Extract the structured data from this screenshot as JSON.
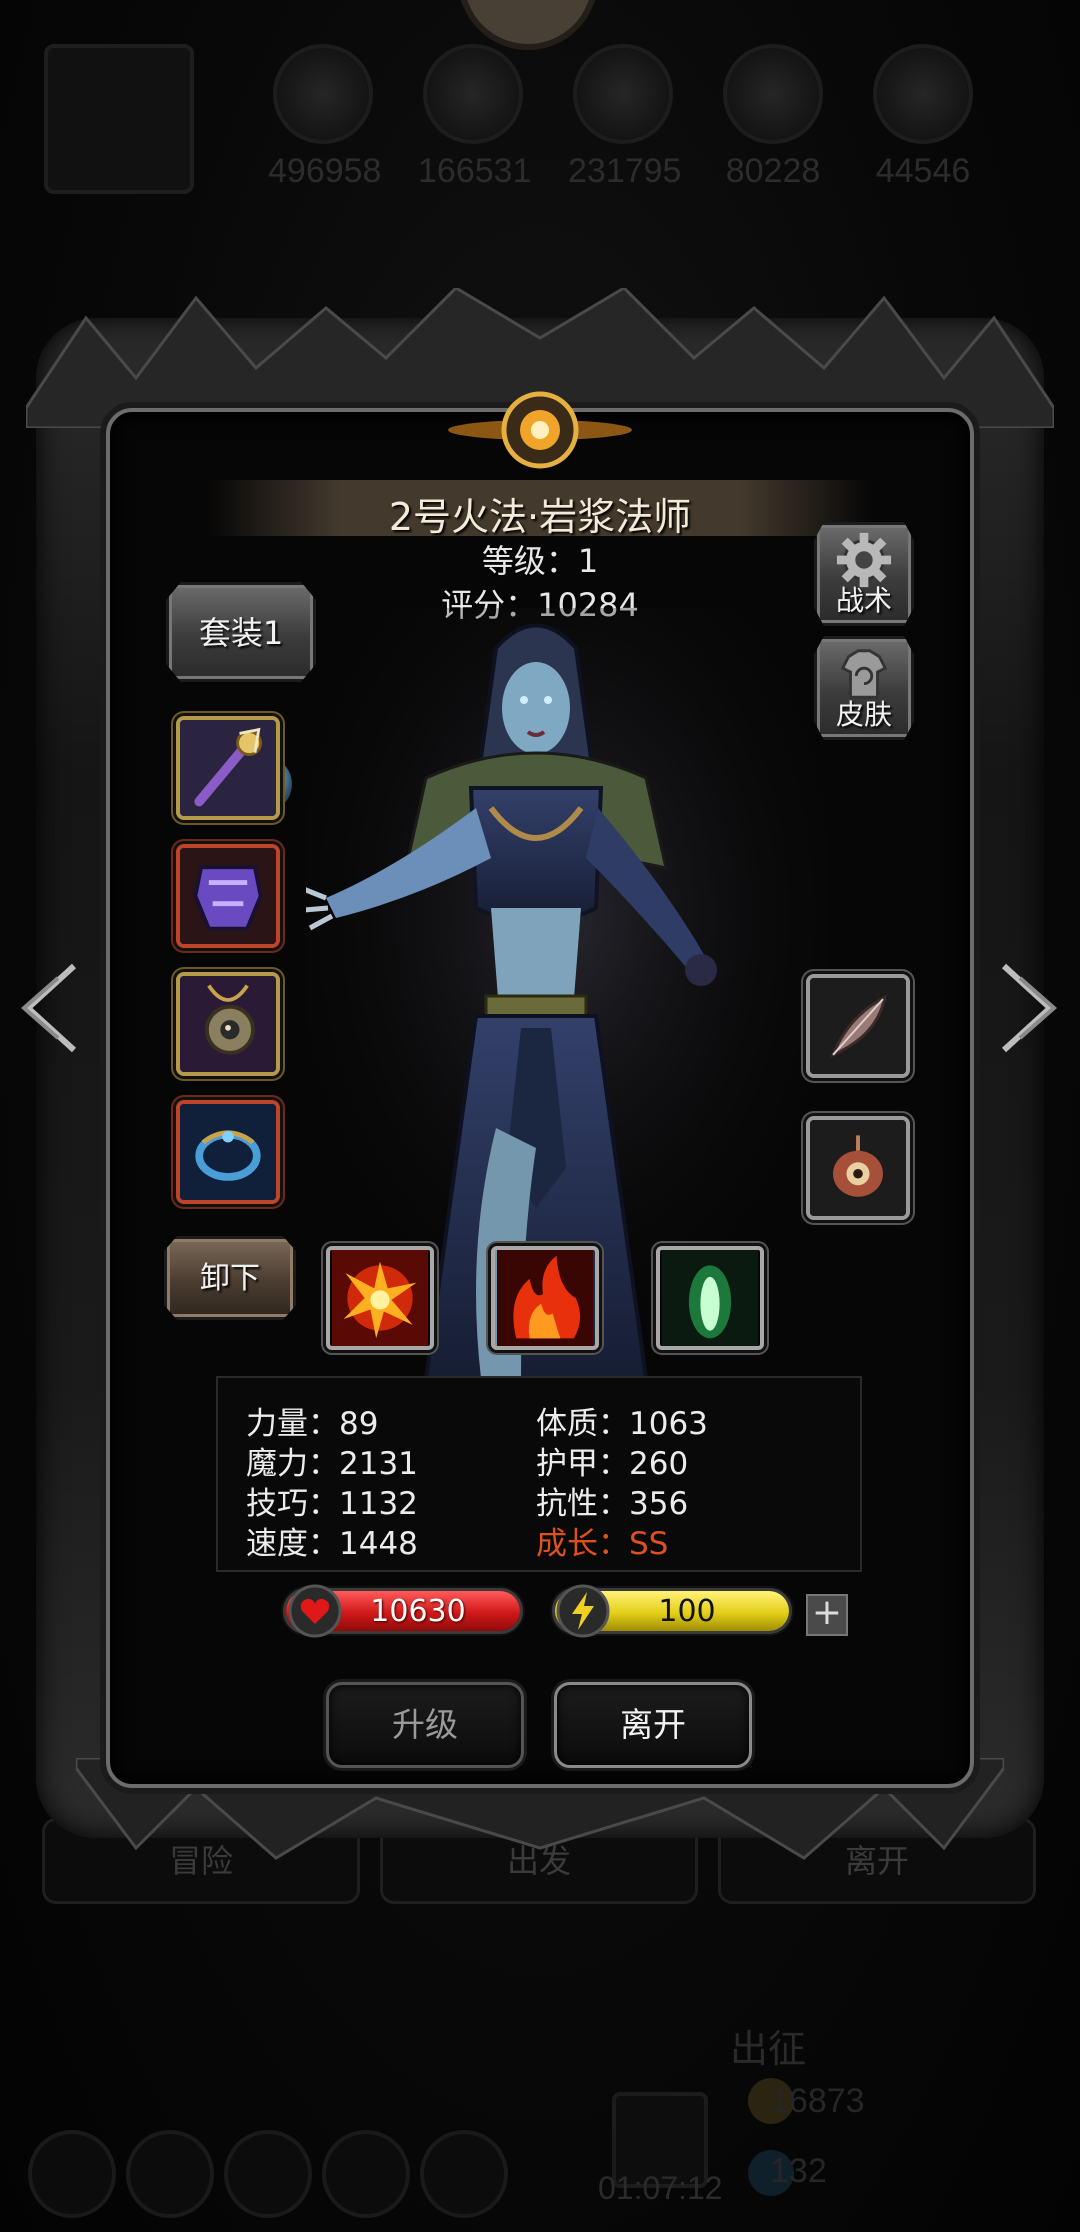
{
  "background": {
    "resources": [
      {
        "icon": "wood-resource-icon",
        "value": "496958"
      },
      {
        "icon": "ore-resource-icon",
        "value": "166531"
      },
      {
        "icon": "iron-resource-icon",
        "value": "231795"
      },
      {
        "icon": "crystal-resource-icon",
        "value": "80228"
      },
      {
        "icon": "hide-resource-icon",
        "value": "44546"
      }
    ],
    "bottom_buttons": [
      "冒险",
      "出发",
      "离开"
    ],
    "expedition_label": "出征",
    "gold_value": "16873",
    "gem_value": "132",
    "timer": "01:07:12"
  },
  "dialog": {
    "hero_name": "2号火法·岩浆法师",
    "level": "等级：1",
    "score": "评分：10284",
    "outfit_button": "套装1",
    "unequip_button": "卸下",
    "tactics_button": "战术",
    "skin_button": "皮肤",
    "equipment": [
      {
        "name": "staff-slot",
        "rarity": "gold"
      },
      {
        "name": "armor-slot",
        "rarity": "red"
      },
      {
        "name": "amulet-slot",
        "rarity": "gold"
      },
      {
        "name": "bracer-slot",
        "rarity": "red"
      }
    ],
    "accessories": [
      "feather-slot",
      "eye-charm-slot"
    ],
    "skills": [
      "fire-burst-skill",
      "flame-skill",
      "green-flame-skill"
    ],
    "stats": {
      "strength": "力量：89",
      "magic": "魔力：2131",
      "skill": "技巧：1132",
      "speed": "速度：1448",
      "constitution": "体质：1063",
      "armor": "护甲：260",
      "resistance": "抗性：356",
      "growth": "成长：SS"
    },
    "hp": {
      "value": "10630",
      "fill": 1.0
    },
    "energy": {
      "value": "100",
      "fill": 1.0
    },
    "plus_label": "+",
    "upgrade_button": "升级",
    "leave_button": "离开"
  },
  "colors": {
    "growth": "#e0501e",
    "hp": "#d01818",
    "energy": "#e4cf18",
    "gold_slot": "#b59a48",
    "red_slot": "#c0442a"
  }
}
